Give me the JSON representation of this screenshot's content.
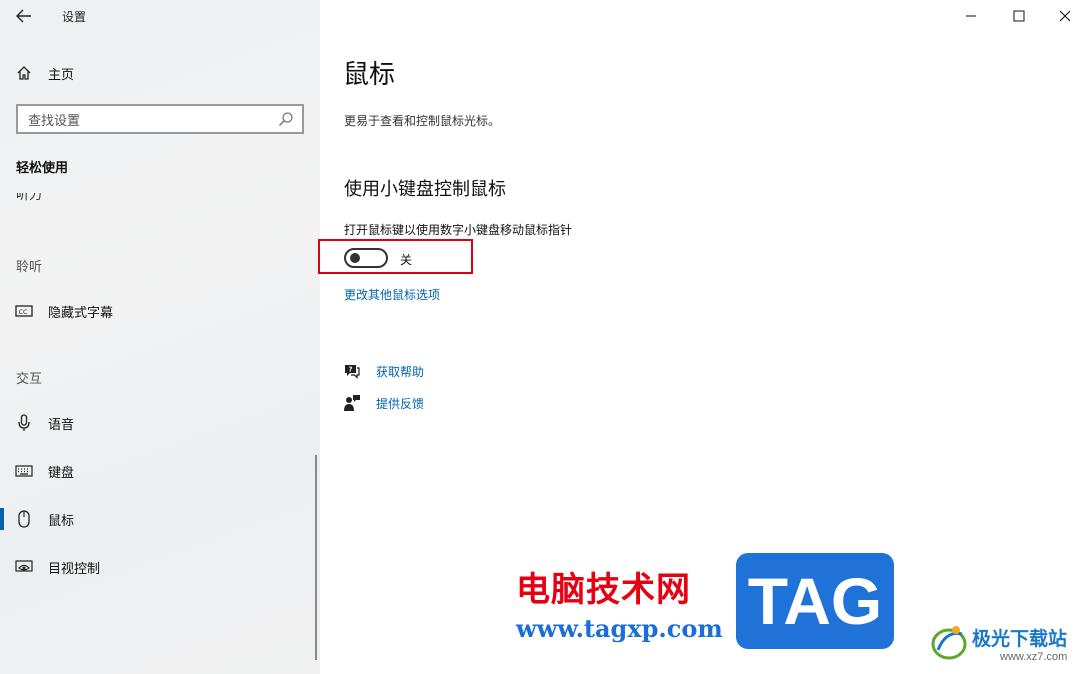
{
  "window": {
    "back_icon": "arrow-left-icon",
    "title": "设置",
    "controls": [
      "minimize-icon",
      "maximize-icon",
      "close-icon"
    ]
  },
  "sidebar": {
    "home_label": "主页",
    "search_placeholder": "查找设置",
    "category": "轻松使用",
    "clipped_item": "听力",
    "group_hearing": "聆听",
    "group_interaction": "交互",
    "items": [
      {
        "label": "隐藏式字幕",
        "icon": "closed-caption-icon"
      },
      {
        "label": "语音",
        "icon": "microphone-icon"
      },
      {
        "label": "键盘",
        "icon": "keyboard-icon"
      },
      {
        "label": "鼠标",
        "icon": "mouse-icon",
        "selected": true
      },
      {
        "label": "目视控制",
        "icon": "eye-control-icon"
      }
    ]
  },
  "main": {
    "title": "鼠标",
    "description": "更易于查看和控制鼠标光标。",
    "section_title": "使用小键盘控制鼠标",
    "option_label": "打开鼠标键以使用数字小键盘移动鼠标指针",
    "toggle_state": "关",
    "toggle_on": false,
    "more_options_link": "更改其他鼠标选项",
    "help_link": "获取帮助",
    "feedback_link": "提供反馈"
  },
  "watermark": {
    "site_name_cn": "电脑技术网",
    "site_url": "www.tagxp.com",
    "tag_logo": "TAG",
    "partner_name": "极光下载站",
    "partner_url": "www.xz7.com"
  },
  "colors": {
    "accent": "#0063b1",
    "highlight_border": "#d9001b",
    "tag_blue": "#1f72d8"
  }
}
